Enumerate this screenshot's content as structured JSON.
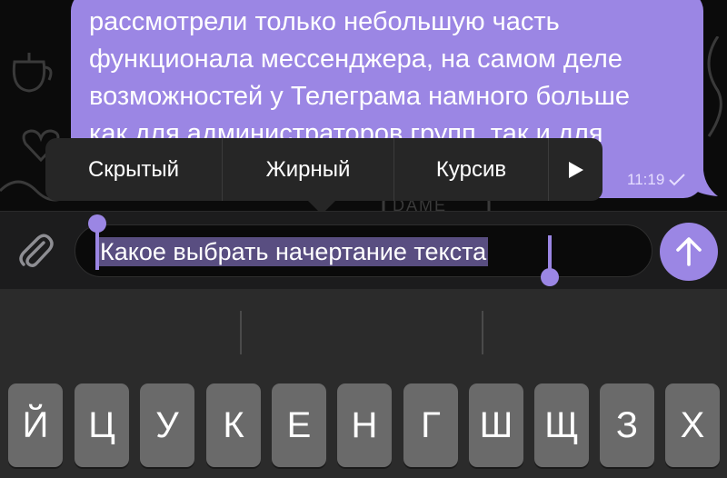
{
  "message": {
    "text": "рассмотрели только небольшую часть\nфункционала мессенджера, на самом деле\nвозможностей у Телеграма намного больше\nкак для администраторов групп, так и для",
    "time": "11:19",
    "status_icon": "check-icon"
  },
  "background_text": "DAME",
  "format_menu": {
    "items": [
      "Скрытый",
      "Жирный",
      "Курсив"
    ],
    "more_icon": "play-arrow-icon"
  },
  "composer": {
    "text": "Какое выбрать начертание текста",
    "attach_icon": "paperclip-icon",
    "send_icon": "arrow-up-icon"
  },
  "keyboard": {
    "row1": [
      "Й",
      "Ц",
      "У",
      "К",
      "Е",
      "Н",
      "Г",
      "Ш",
      "Щ",
      "З",
      "Х"
    ]
  },
  "colors": {
    "accent": "#9b86e4",
    "bubble_text": "#ffffff",
    "keyboard_bg": "#2b2b2b",
    "key_bg": "#6a6a6a"
  }
}
